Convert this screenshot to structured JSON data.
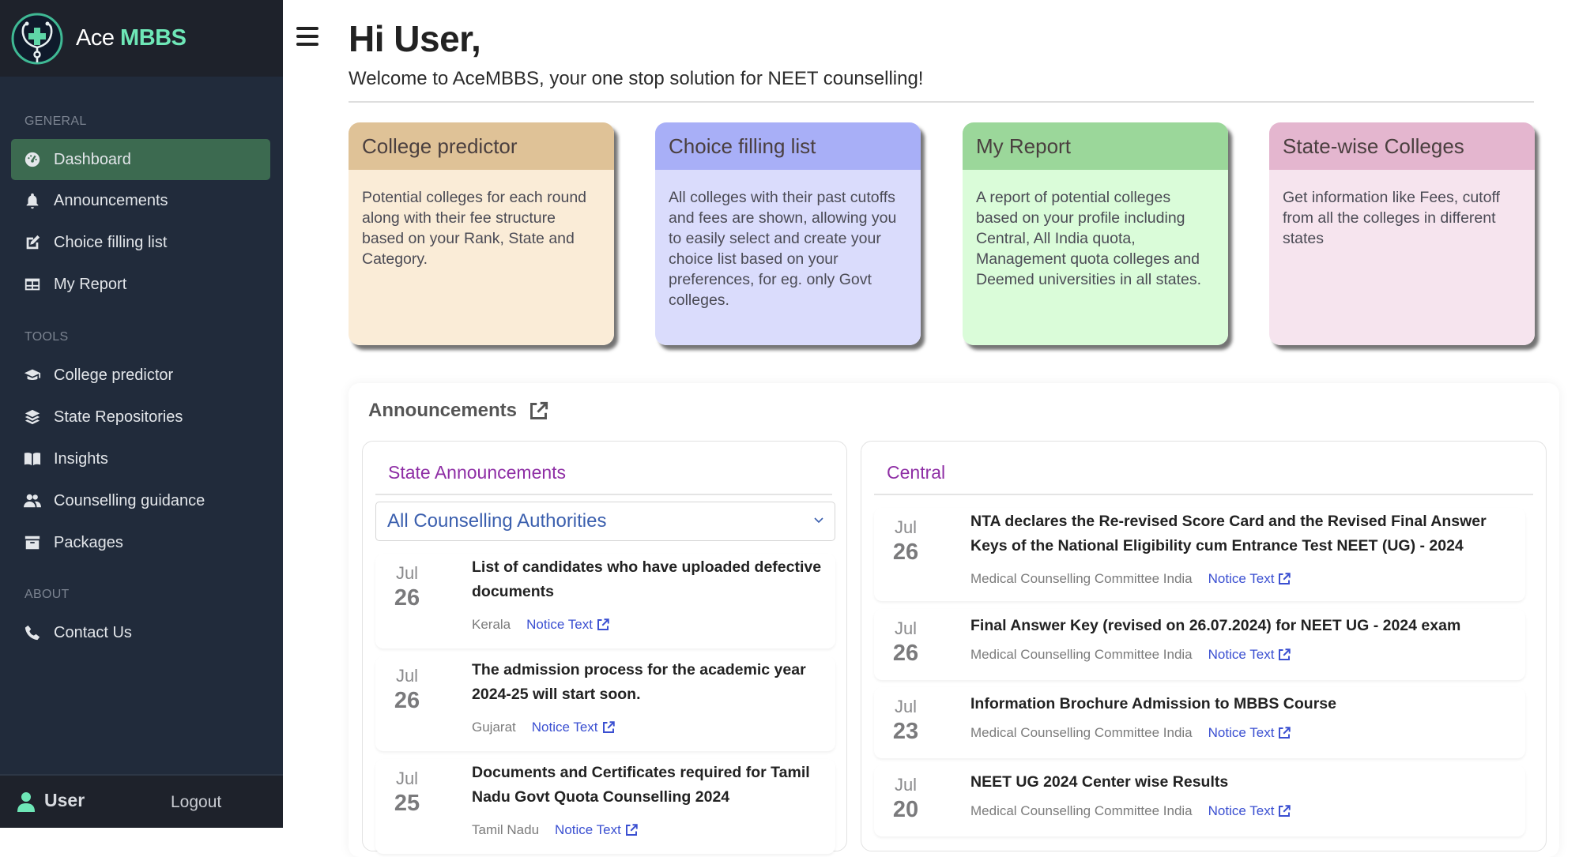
{
  "brand": {
    "name_prefix": "Ace",
    "name_accent": "MBBS"
  },
  "sidebar": {
    "sections": [
      {
        "label": "GENERAL",
        "items": [
          {
            "label": "Dashboard",
            "icon": "gauge-icon",
            "active": true
          },
          {
            "label": "Announcements",
            "icon": "bell-icon"
          },
          {
            "label": "Choice filling list",
            "icon": "edit-icon"
          },
          {
            "label": "My Report",
            "icon": "table-icon"
          }
        ]
      },
      {
        "label": "TOOLS",
        "items": [
          {
            "label": "College predictor",
            "icon": "graduation-cap-icon"
          },
          {
            "label": "State Repositories",
            "icon": "layers-icon"
          },
          {
            "label": "Insights",
            "icon": "book-open-icon"
          },
          {
            "label": "Counselling guidance",
            "icon": "users-icon"
          },
          {
            "label": "Packages",
            "icon": "archive-icon"
          }
        ]
      },
      {
        "label": "ABOUT",
        "items": [
          {
            "label": "Contact Us",
            "icon": "phone-icon"
          }
        ]
      }
    ],
    "footer": {
      "user": "User",
      "logout": "Logout"
    }
  },
  "header": {
    "greeting": "Hi User,",
    "welcome": "Welcome to AceMBBS, your one stop solution for NEET counselling!"
  },
  "cards": [
    {
      "title": "College predictor",
      "body": "Potential colleges for each round along with their fee structure based on your Rank, State and Category.",
      "head_color": "#dfc297",
      "body_color": "#faecd7"
    },
    {
      "title": "Choice filling list",
      "body": "All colleges with their past cutoffs and fees are shown, allowing you to easily select and create your choice list based on your preferences, for eg. only Govt colleges.",
      "head_color": "#a8aff7",
      "body_color": "#dadcfc"
    },
    {
      "title": "My Report",
      "body": "A report of potential colleges based on your profile including Central, All India quota, Management quota colleges and Deemed universities in all states.",
      "head_color": "#9bd79a",
      "body_color": "#dafcd9"
    },
    {
      "title": "State-wise Colleges",
      "body": "Get information like Fees, cutoff from all the colleges in different states",
      "head_color": "#e4b6cf",
      "body_color": "#f6e4ee"
    }
  ],
  "announcements": {
    "title": "Announcements",
    "state": {
      "title": "State Announcements",
      "filter_value": "All Counselling Authorities",
      "items": [
        {
          "month": "Jul",
          "day": "26",
          "title": "List of candidates who have uploaded defective documents",
          "source": "Kerala",
          "link": "Notice Text"
        },
        {
          "month": "Jul",
          "day": "26",
          "title": "The admission process for the academic year 2024-25 will start soon.",
          "source": "Gujarat",
          "link": "Notice Text"
        },
        {
          "month": "Jul",
          "day": "25",
          "title": "Documents and Certificates required for Tamil Nadu Govt Quota Counselling 2024",
          "source": "Tamil Nadu",
          "link": "Notice Text"
        }
      ]
    },
    "central": {
      "title": "Central",
      "items": [
        {
          "month": "Jul",
          "day": "26",
          "title": "NTA declares the Re-revised Score Card and the Revised Final Answer Keys of the National Eligibility cum Entrance Test NEET (UG) - 2024",
          "source": "Medical Counselling Committee India",
          "link": "Notice Text"
        },
        {
          "month": "Jul",
          "day": "26",
          "title": "Final Answer Key (revised on 26.07.2024) for NEET UG - 2024 exam",
          "source": "Medical Counselling Committee India",
          "link": "Notice Text"
        },
        {
          "month": "Jul",
          "day": "23",
          "title": "Information Brochure Admission to MBBS Course",
          "source": "Medical Counselling Committee India",
          "link": "Notice Text"
        },
        {
          "month": "Jul",
          "day": "20",
          "title": "NEET UG 2024 Center wise Results",
          "source": "Medical Counselling Committee India",
          "link": "Notice Text"
        }
      ]
    }
  },
  "colors": {
    "accent": "#6ee7b7",
    "active_nav": "#3c6a50",
    "sidebar_bg": "#212b3b",
    "section_title": "#8e2ea5",
    "link": "#3a4fd1"
  }
}
